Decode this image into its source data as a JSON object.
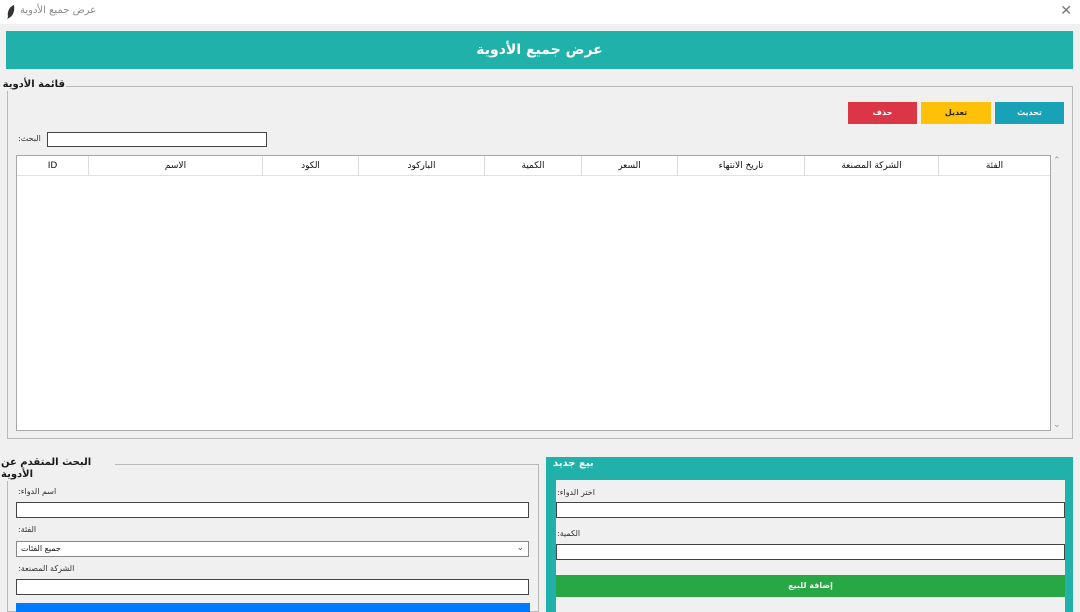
{
  "window": {
    "title": "عرض جميع الأدوية",
    "close_glyph": "✕"
  },
  "header": {
    "title": "عرض جميع الأدوية"
  },
  "medicines_list": {
    "legend": "قائمة الأدوية",
    "buttons": {
      "refresh": "تحديث",
      "edit": "تعديل",
      "delete": "حذف"
    },
    "search_label": ":البحث",
    "search_value": "",
    "columns": [
      "ID",
      "الاسم",
      "الكود",
      "الباركود",
      "الكمية",
      "السعر",
      "تاريخ الانتهاء",
      "الشركة المصنعة",
      "الفئة"
    ],
    "rows": []
  },
  "advanced_search": {
    "legend": "البحث المتقدم عن الأدوية",
    "name_label": ":اسم الدواء",
    "name_value": "",
    "category_label": ":الفئة",
    "category_value": "جميع الفئات",
    "company_label": ":الشركة المصنعة",
    "company_value": ""
  },
  "new_sale": {
    "title": "بيع جديد",
    "choose_label": ":اختر الدواء",
    "quantity_label": ":الكمية",
    "add_button": "إضافة للبيع"
  },
  "colors": {
    "teal": "#20b2aa",
    "refresh": "#17a2b8",
    "edit": "#ffc107",
    "delete": "#dc3545",
    "add": "#28a745",
    "search_button": "#007bff"
  }
}
